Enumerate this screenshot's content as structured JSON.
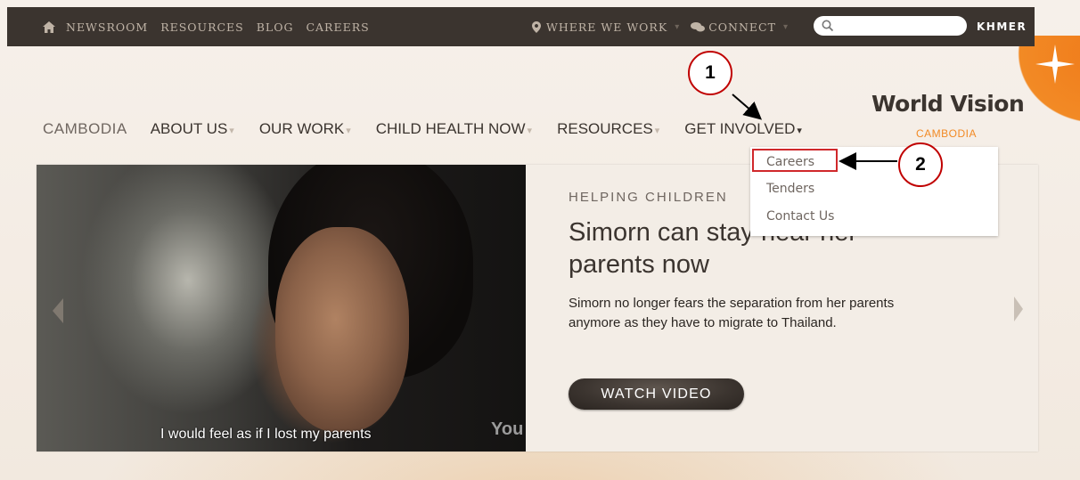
{
  "topbar": {
    "links": [
      "NEWSROOM",
      "RESOURCES",
      "BLOG",
      "CAREERS"
    ],
    "where_we_work": "WHERE WE WORK",
    "connect": "CONNECT",
    "search_placeholder": "",
    "language": "KHMER"
  },
  "brand": {
    "name": "World Vision",
    "country": "CAMBODIA"
  },
  "mainnav": {
    "country": "CAMBODIA",
    "items": [
      "ABOUT US",
      "OUR WORK",
      "CHILD HEALTH NOW",
      "RESOURCES",
      "GET INVOLVED"
    ]
  },
  "dropdown": {
    "items": [
      "Careers",
      "Tenders",
      "Contact Us"
    ]
  },
  "hero": {
    "kicker": "HELPING CHILDREN",
    "headline": "Simorn can stay near her parents now",
    "body": "Simorn no longer fears the separation from her parents anymore as they have to migrate to Thailand.",
    "button": "WATCH VIDEO",
    "video_subtitle": "I would feel as if I lost my parents",
    "video_logo": "You"
  },
  "annotations": {
    "step1": "1",
    "step2": "2"
  },
  "colors": {
    "topbar": "#3b342f",
    "accent": "#f28a25",
    "annotation": "#c00000"
  }
}
